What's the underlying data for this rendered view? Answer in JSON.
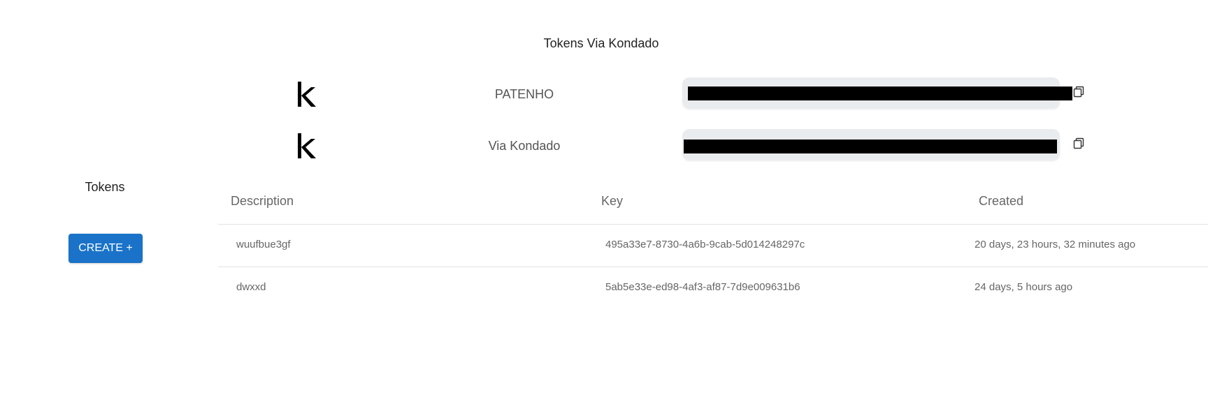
{
  "header": {
    "title": "Tokens Via Kondado"
  },
  "kondado_tokens": [
    {
      "label": "PATENHO",
      "logo_icon": "kondado-k-logo",
      "field_icon": "copy-icon"
    },
    {
      "label": "Via Kondado",
      "logo_icon": "kondado-k-logo",
      "field_icon": "copy-icon"
    }
  ],
  "sidebar": {
    "title": "Tokens",
    "create_label": "CREATE +"
  },
  "table": {
    "headers": {
      "description": "Description",
      "key": "Key",
      "created": "Created"
    },
    "rows": [
      {
        "description": "wuufbue3gf",
        "key": "495a33e7-8730-4a6b-9cab-5d014248297c",
        "created": "20 days, 23 hours, 32 minutes ago"
      },
      {
        "description": "dwxxd",
        "key": "5ab5e33e-ed98-4af3-af87-7d9e009631b6",
        "created": "24 days, 5 hours ago"
      }
    ]
  },
  "colors": {
    "accent": "#1a73c8",
    "field_bg": "#e9ecef",
    "redaction": "#000000"
  }
}
